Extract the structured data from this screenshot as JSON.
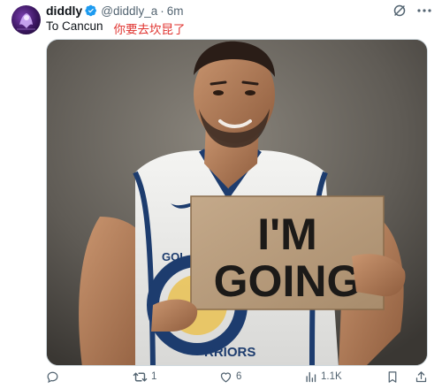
{
  "author": {
    "display_name": "diddly",
    "handle": "@diddly_a",
    "separator": "·",
    "time": "6m"
  },
  "tweet": {
    "text_en": "To Cancun",
    "text_zh": "你要去坎昆了"
  },
  "media": {
    "sign_line1": "I'M",
    "sign_line2": "GOING",
    "jersey_text_left": "GOL",
    "jersey_text_bottom": "RRIORS"
  },
  "actions": {
    "replies": "",
    "reposts": "1",
    "likes": "6",
    "views": "1.1K"
  },
  "icons": [
    "verified-badge-icon",
    "grok-icon",
    "more-icon",
    "reply-icon",
    "repost-icon",
    "like-icon",
    "views-icon",
    "bookmark-icon",
    "share-icon"
  ],
  "colors": {
    "verified": "#1d9bf0",
    "secondary_text": "#536471",
    "highlight_text": "#e0332f"
  }
}
